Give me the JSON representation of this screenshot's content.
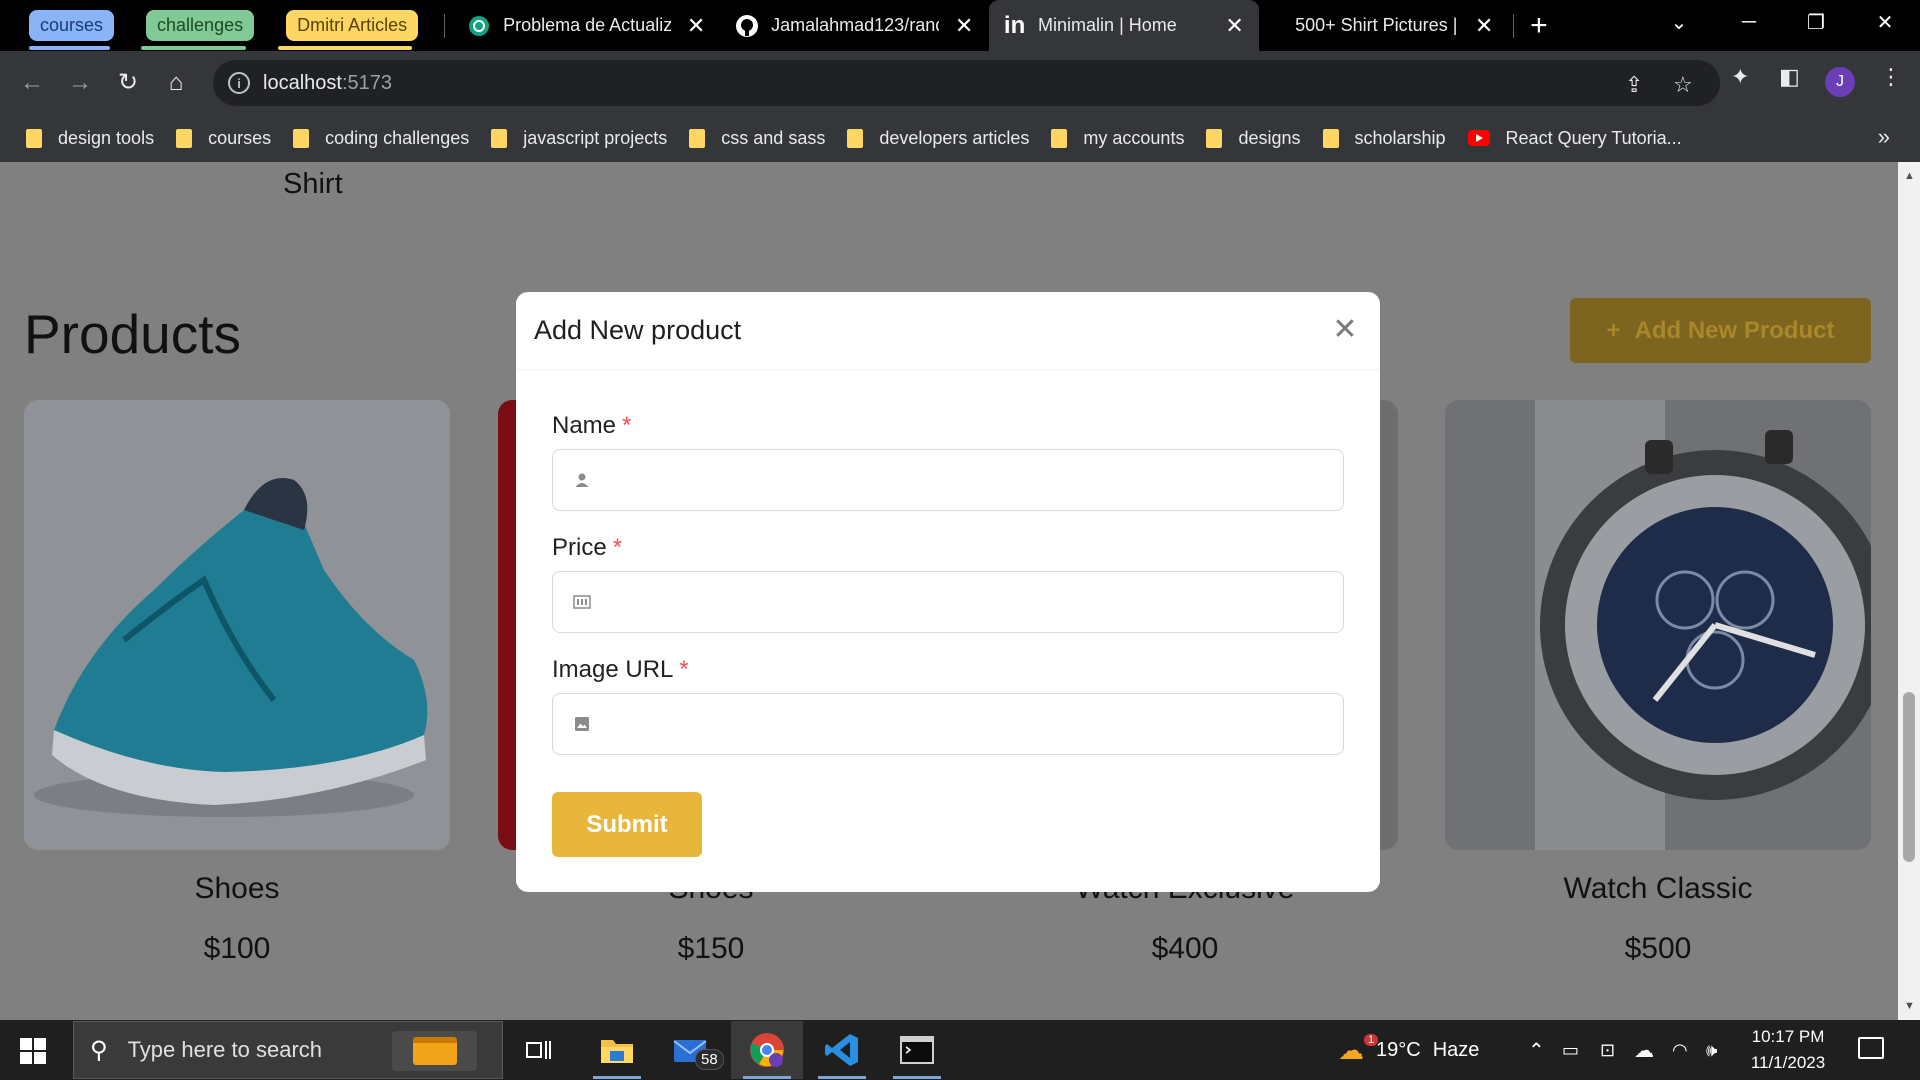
{
  "browser": {
    "tab_groups": [
      {
        "label": "courses",
        "color": "#8ab4f8"
      },
      {
        "label": "challenges",
        "color": "#81c995"
      },
      {
        "label": "Dmitri Articles",
        "color": "#fdd663"
      }
    ],
    "tabs": [
      {
        "title": "Problema de Actualiz",
        "icon": "openai-icon",
        "active": false
      },
      {
        "title": "Jamalahmad123/rand",
        "icon": "github-icon",
        "active": false
      },
      {
        "title": "Minimalin | Home",
        "icon": "linkedin-icon",
        "active": true
      },
      {
        "title": "500+ Shirt Pictures | [",
        "icon": "unsplash-icon",
        "active": false
      }
    ],
    "url_host": "localhost",
    "url_port": ":5173",
    "profile_initial": "J",
    "bookmarks": [
      {
        "label": "design tools",
        "icon": "folder-icon"
      },
      {
        "label": "courses",
        "icon": "folder-icon"
      },
      {
        "label": "coding challenges",
        "icon": "folder-icon"
      },
      {
        "label": "javascript projects",
        "icon": "folder-icon"
      },
      {
        "label": "css and sass",
        "icon": "folder-icon"
      },
      {
        "label": "developers articles",
        "icon": "folder-icon"
      },
      {
        "label": "my accounts",
        "icon": "folder-icon"
      },
      {
        "label": "designs",
        "icon": "folder-icon"
      },
      {
        "label": "scholarship",
        "icon": "folder-icon"
      },
      {
        "label": "React Query Tutoria...",
        "icon": "youtube-icon"
      }
    ]
  },
  "page": {
    "previous_item_label": "Shirt",
    "products_title": "Products",
    "add_button_label": "Add New Product",
    "products": [
      {
        "name": "Shoes",
        "price": "$100"
      },
      {
        "name": "Shoes",
        "price": "$150"
      },
      {
        "name": "Watch Exclusive",
        "price": "$400"
      },
      {
        "name": "Watch Classic",
        "price": "$500"
      }
    ]
  },
  "modal": {
    "title": "Add New product",
    "fields": [
      {
        "label": "Name",
        "icon": "user-icon",
        "value": "",
        "required": true
      },
      {
        "label": "Price",
        "icon": "money-icon",
        "value": "",
        "required": true
      },
      {
        "label": "Image URL",
        "icon": "image-icon",
        "value": "",
        "required": true
      }
    ],
    "required_mark": "*",
    "submit_label": "Submit"
  },
  "taskbar": {
    "search_placeholder": "Type here to search",
    "mail_badge": "58",
    "weather_temp": "19°C",
    "weather_desc": "Haze",
    "weather_alert": "1",
    "time": "10:17 PM",
    "date": "11/1/2023"
  },
  "colors": {
    "accent": "#e8b63a",
    "required": "#ff4d4f",
    "chrome_dark": "#35363a"
  }
}
